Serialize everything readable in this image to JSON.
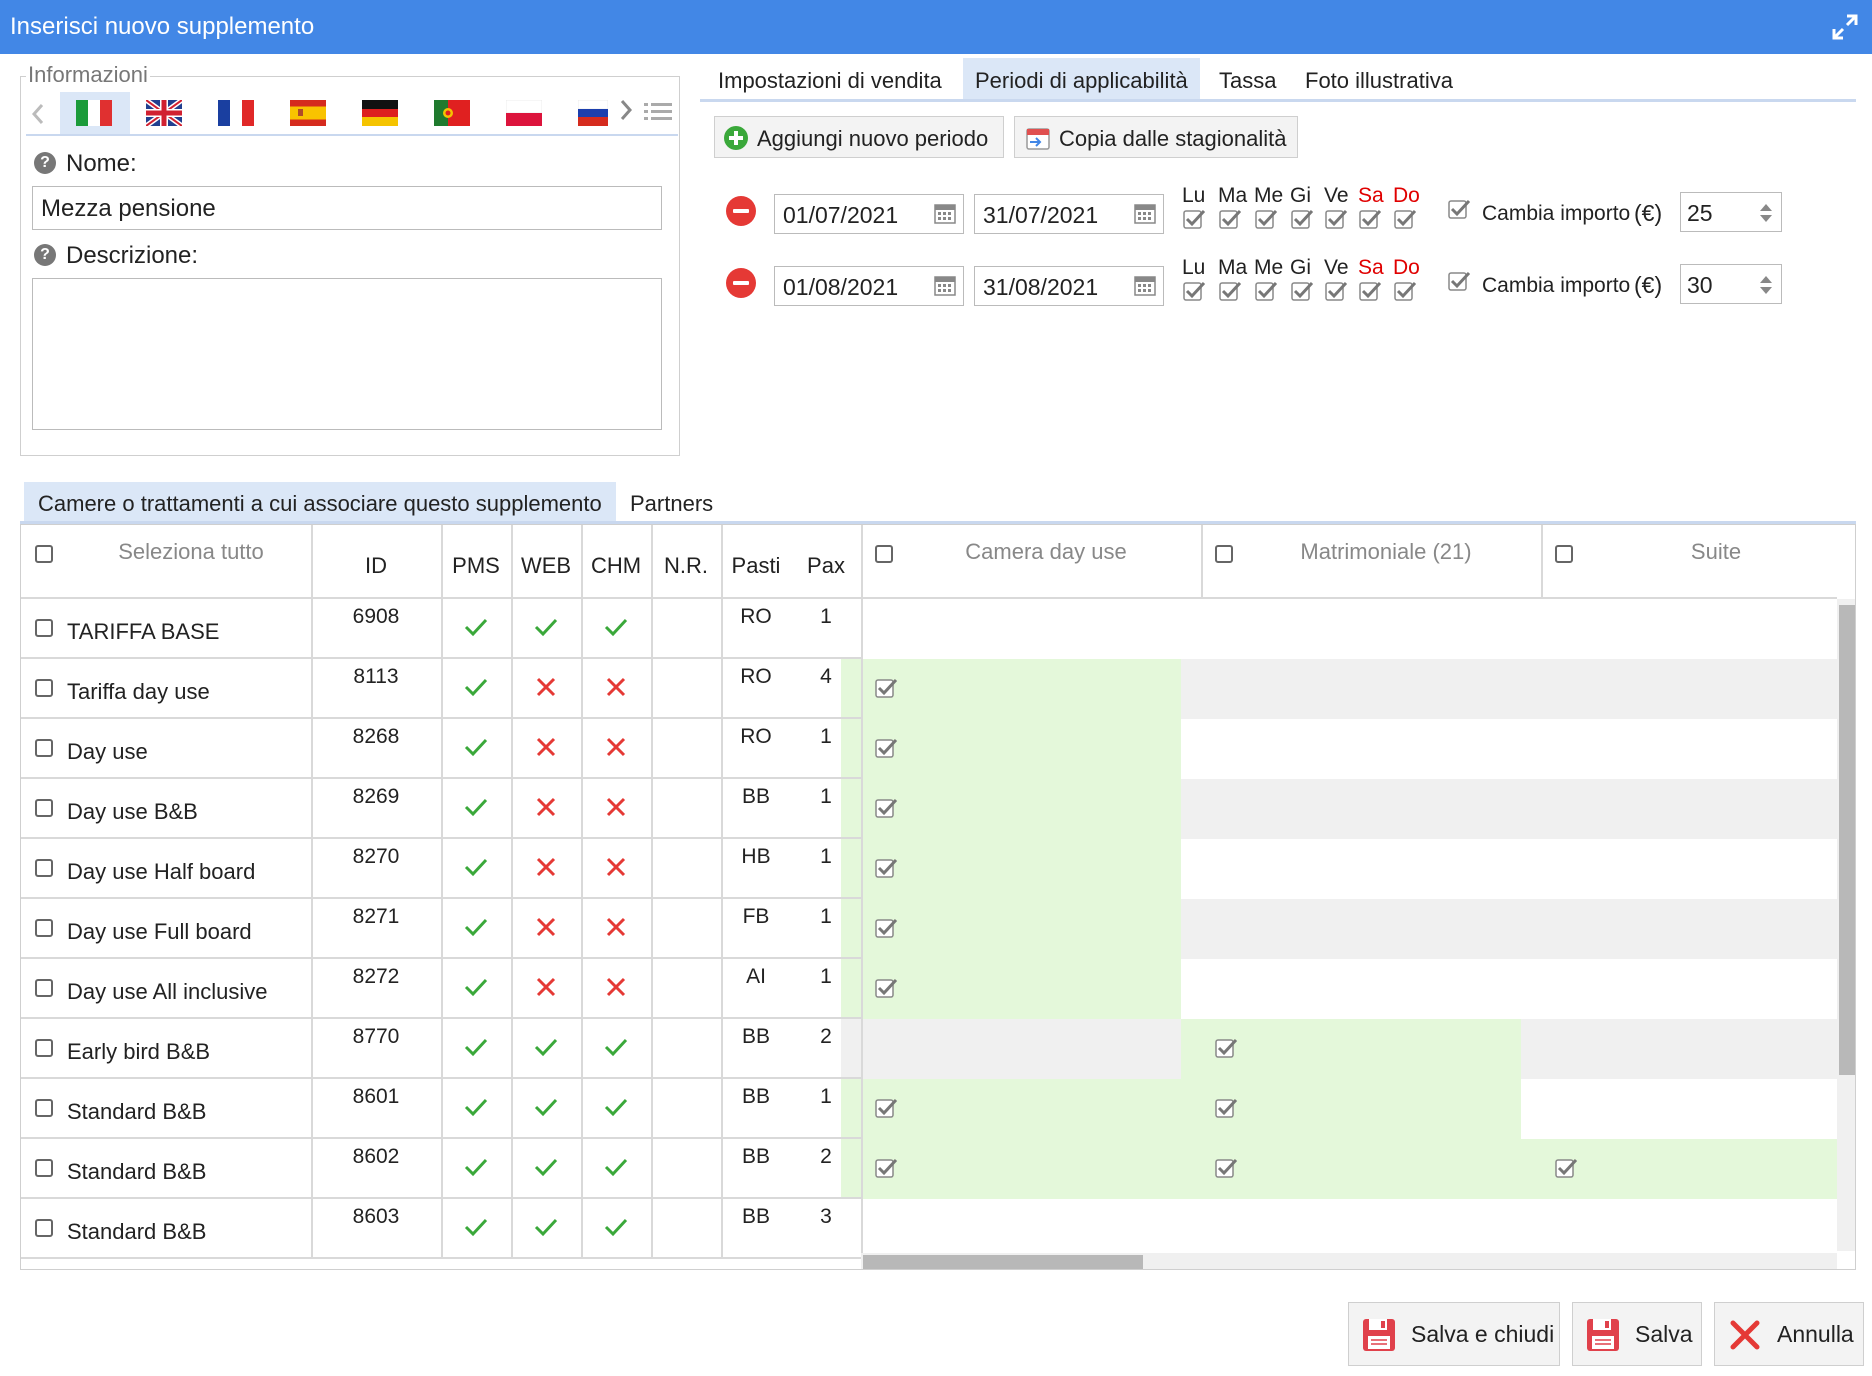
{
  "window": {
    "title": "Inserisci nuovo supplemento",
    "expand_icon": "expand-icon"
  },
  "info": {
    "legend": "Informazioni",
    "languages": [
      "it",
      "en",
      "fr",
      "es",
      "de",
      "pt",
      "pl",
      "ru"
    ],
    "name_label": "Nome:",
    "name_value": "Mezza pensione",
    "description_label": "Descrizione:",
    "description_value": ""
  },
  "right_tabs": [
    "Impostazioni di vendita",
    "Periodi di applicabilità",
    "Tassa",
    "Foto illustrativa"
  ],
  "active_right_tab": "Periodi di applicabilità",
  "periods": {
    "add_button": "Aggiungi nuovo periodo",
    "copy_button": "Copia dalle stagionalità",
    "day_labels": [
      "Lu",
      "Ma",
      "Me",
      "Gi",
      "Ve",
      "Sa",
      "Do"
    ],
    "change_amount_label": "Cambia importo",
    "currency": "(€)",
    "rows": [
      {
        "from": "01/07/2021",
        "to": "31/07/2021",
        "amount": "25"
      },
      {
        "from": "01/08/2021",
        "to": "31/08/2021",
        "amount": "30"
      }
    ]
  },
  "bottom_tabs": [
    "Camere o trattamenti a cui associare questo supplemento",
    "Partners"
  ],
  "grid": {
    "select_all": "Seleziona tutto",
    "columns": [
      "ID",
      "PMS",
      "WEB",
      "CHM",
      "N.R.",
      "Pasti",
      "Pax"
    ],
    "room_columns": [
      "Camera day use",
      "Matrimoniale (21)",
      "Suite"
    ],
    "rows": [
      {
        "name": "TARIFFA BASE",
        "id": "6908",
        "pms": true,
        "web": true,
        "chm": true,
        "pasti": "RO",
        "pax": "1",
        "rooms": [
          false,
          false,
          false
        ]
      },
      {
        "name": "Tariffa day use",
        "id": "8113",
        "pms": true,
        "web": false,
        "chm": false,
        "pasti": "RO",
        "pax": "4",
        "rooms": [
          true,
          false,
          false
        ]
      },
      {
        "name": "Day use",
        "id": "8268",
        "pms": true,
        "web": false,
        "chm": false,
        "pasti": "RO",
        "pax": "1",
        "rooms": [
          true,
          false,
          false
        ]
      },
      {
        "name": "Day use B&B",
        "id": "8269",
        "pms": true,
        "web": false,
        "chm": false,
        "pasti": "BB",
        "pax": "1",
        "rooms": [
          true,
          false,
          false
        ]
      },
      {
        "name": "Day use Half board",
        "id": "8270",
        "pms": true,
        "web": false,
        "chm": false,
        "pasti": "HB",
        "pax": "1",
        "rooms": [
          true,
          false,
          false
        ]
      },
      {
        "name": "Day use Full board",
        "id": "8271",
        "pms": true,
        "web": false,
        "chm": false,
        "pasti": "FB",
        "pax": "1",
        "rooms": [
          true,
          false,
          false
        ]
      },
      {
        "name": "Day use All inclusive",
        "id": "8272",
        "pms": true,
        "web": false,
        "chm": false,
        "pasti": "AI",
        "pax": "1",
        "rooms": [
          true,
          false,
          false
        ]
      },
      {
        "name": "Early bird B&B",
        "id": "8770",
        "pms": true,
        "web": true,
        "chm": true,
        "pasti": "BB",
        "pax": "2",
        "rooms": [
          false,
          true,
          false
        ]
      },
      {
        "name": "Standard B&B",
        "id": "8601",
        "pms": true,
        "web": true,
        "chm": true,
        "pasti": "BB",
        "pax": "1",
        "rooms": [
          true,
          true,
          false
        ]
      },
      {
        "name": "Standard B&B",
        "id": "8602",
        "pms": true,
        "web": true,
        "chm": true,
        "pasti": "BB",
        "pax": "2",
        "rooms": [
          true,
          true,
          true
        ]
      },
      {
        "name": "Standard B&B",
        "id": "8603",
        "pms": true,
        "web": true,
        "chm": true,
        "pasti": "BB",
        "pax": "3",
        "rooms": [
          false,
          false,
          false
        ]
      }
    ]
  },
  "footer": {
    "save_close": "Salva e chiudi",
    "save": "Salva",
    "cancel": "Annulla"
  },
  "colors": {
    "titlebar": "#4287e6",
    "tab_active": "#dbe7f7",
    "check_green": "#3aa83a",
    "cross_red": "#e53935",
    "room_green": "#e4f8da",
    "weekend_red": "#e00000"
  }
}
